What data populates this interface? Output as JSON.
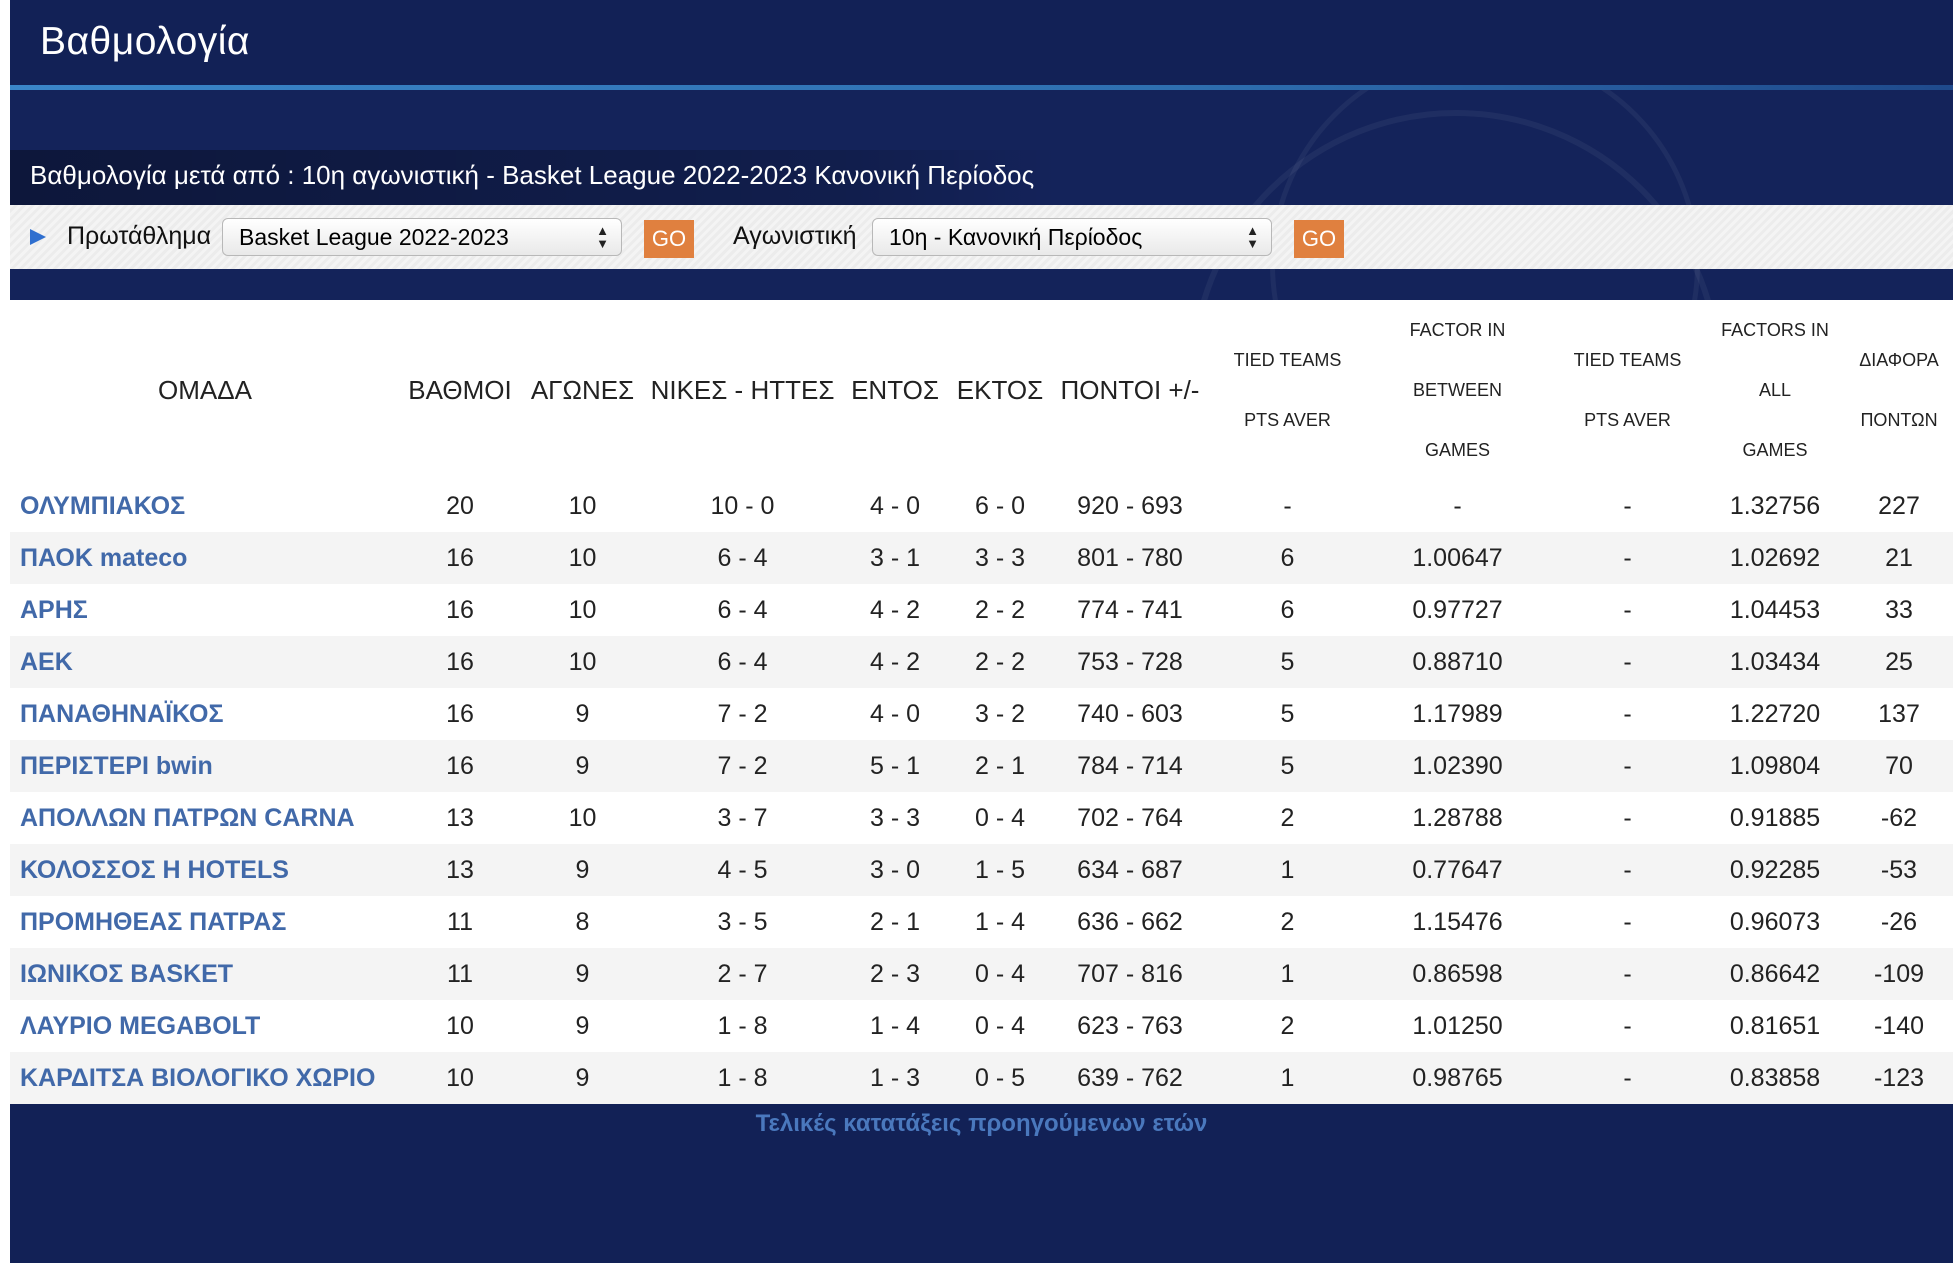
{
  "header": {
    "title": "Βαθμολογία"
  },
  "subtitle": "Βαθμολογία μετά από : 10η αγωνιστική - Basket League 2022-2023 Κανονική Περίοδος",
  "filters": {
    "championship_label": "Πρωτάθλημα",
    "championship_value": "Basket League 2022-2023",
    "round_label": "Αγωνιστική",
    "round_value": "10η - Κανονική Περίοδος",
    "go_label": "GO"
  },
  "table": {
    "headers": {
      "team": "ΟΜΑΔΑ",
      "points": "ΒΑΘΜΟΙ",
      "games": "ΑΓΩΝΕΣ",
      "wins_losses": "ΝΙΚΕΣ - ΗΤΤΕΣ",
      "home": "ΕΝΤΟΣ",
      "away": "ΕΚΤΟΣ",
      "pts_plus_minus": "ΠΟΝΤΟΙ +/-",
      "tied_teams_1_a": "TIED TEAMS",
      "tied_teams_1_b": "PTS AVER",
      "factor_between_a": "FACTOR IN BETWEEN",
      "factor_between_b": "GAMES",
      "tied_teams_2_a": "TIED TEAMS",
      "tied_teams_2_b": "PTS AVER",
      "factors_all_a": "FACTORS IN ALL",
      "factors_all_b": "GAMES",
      "diff_a": "ΔΙΑΦΟΡΑ",
      "diff_b": "ΠΟΝΤΩΝ"
    },
    "rows": [
      [
        "ΟΛΥΜΠΙΑΚΟΣ",
        "20",
        "10",
        "10 - 0",
        "4 - 0",
        "6 - 0",
        "920 - 693",
        "-",
        "-",
        "-",
        "1.32756",
        "227"
      ],
      [
        "ΠΑΟΚ mateco",
        "16",
        "10",
        "6 - 4",
        "3 - 1",
        "3 - 3",
        "801 - 780",
        "6",
        "1.00647",
        "-",
        "1.02692",
        "21"
      ],
      [
        "ΑΡΗΣ",
        "16",
        "10",
        "6 - 4",
        "4 - 2",
        "2 - 2",
        "774 - 741",
        "6",
        "0.97727",
        "-",
        "1.04453",
        "33"
      ],
      [
        "ΑΕΚ",
        "16",
        "10",
        "6 - 4",
        "4 - 2",
        "2 - 2",
        "753 - 728",
        "5",
        "0.88710",
        "-",
        "1.03434",
        "25"
      ],
      [
        "ΠΑΝΑΘΗΝΑΪΚΟΣ",
        "16",
        "9",
        "7 - 2",
        "4 - 0",
        "3 - 2",
        "740 - 603",
        "5",
        "1.17989",
        "-",
        "1.22720",
        "137"
      ],
      [
        "ΠΕΡΙΣΤΕΡΙ bwin",
        "16",
        "9",
        "7 - 2",
        "5 - 1",
        "2 - 1",
        "784 - 714",
        "5",
        "1.02390",
        "-",
        "1.09804",
        "70"
      ],
      [
        "ΑΠΟΛΛΩΝ ΠΑΤΡΩΝ CARNA",
        "13",
        "10",
        "3 - 7",
        "3 - 3",
        "0 - 4",
        "702 - 764",
        "2",
        "1.28788",
        "-",
        "0.91885",
        "-62"
      ],
      [
        "ΚΟΛΟΣΣΟΣ H HOTELS",
        "13",
        "9",
        "4 - 5",
        "3 - 0",
        "1 - 5",
        "634 - 687",
        "1",
        "0.77647",
        "-",
        "0.92285",
        "-53"
      ],
      [
        "ΠΡΟΜΗΘΕΑΣ ΠΑΤΡΑΣ",
        "11",
        "8",
        "3 - 5",
        "2 - 1",
        "1 - 4",
        "636 - 662",
        "2",
        "1.15476",
        "-",
        "0.96073",
        "-26"
      ],
      [
        "ΙΩΝΙΚΟΣ BASKET",
        "11",
        "9",
        "2 - 7",
        "2 - 3",
        "0 - 4",
        "707 - 816",
        "1",
        "0.86598",
        "-",
        "0.86642",
        "-109"
      ],
      [
        "ΛΑΥΡΙΟ MEGABOLT",
        "10",
        "9",
        "1 - 8",
        "1 - 4",
        "0 - 4",
        "623 - 763",
        "2",
        "1.01250",
        "-",
        "0.81651",
        "-140"
      ],
      [
        "ΚΑΡΔΙΤΣΑ ΒΙΟΛΟΓΙΚΟ ΧΩΡΙΟ",
        "10",
        "9",
        "1 - 8",
        "1 - 3",
        "0 - 5",
        "639 - 762",
        "1",
        "0.98765",
        "-",
        "0.83858",
        "-123"
      ]
    ]
  },
  "footer": {
    "link_label": "Τελικές κατατάξεις προηγούμενων ετών"
  }
}
